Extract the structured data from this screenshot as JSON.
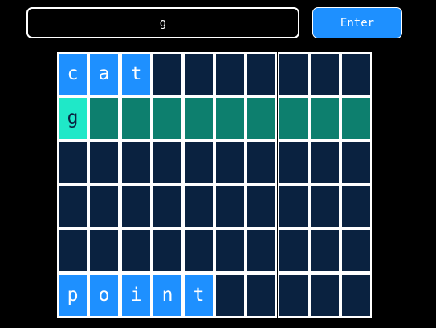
{
  "input": {
    "value": "g",
    "placeholder": ""
  },
  "enter_button": {
    "label": "Enter"
  },
  "colors": {
    "background": "#000000",
    "empty_cell": "#0a2240",
    "filled_cell": "#1e90ff",
    "active_cell": "#1fe8c8",
    "pending_cell": "#0d7f6e",
    "border": "#ffffff"
  },
  "grid": {
    "rows": [
      {
        "state": "filled",
        "letters": [
          "c",
          "a",
          "t",
          "",
          "",
          "",
          "",
          "",
          "",
          ""
        ]
      },
      {
        "state": "active",
        "letters": [
          "g",
          "",
          "",
          "",
          "",
          "",
          "",
          "",
          "",
          ""
        ]
      },
      {
        "state": "empty",
        "letters": [
          "",
          "",
          "",
          "",
          "",
          "",
          "",
          "",
          "",
          ""
        ]
      },
      {
        "state": "empty",
        "letters": [
          "",
          "",
          "",
          "",
          "",
          "",
          "",
          "",
          "",
          ""
        ]
      },
      {
        "state": "empty",
        "letters": [
          "",
          "",
          "",
          "",
          "",
          "",
          "",
          "",
          "",
          ""
        ]
      },
      {
        "state": "filled",
        "letters": [
          "p",
          "o",
          "i",
          "n",
          "t",
          "",
          "",
          "",
          "",
          ""
        ]
      }
    ]
  }
}
